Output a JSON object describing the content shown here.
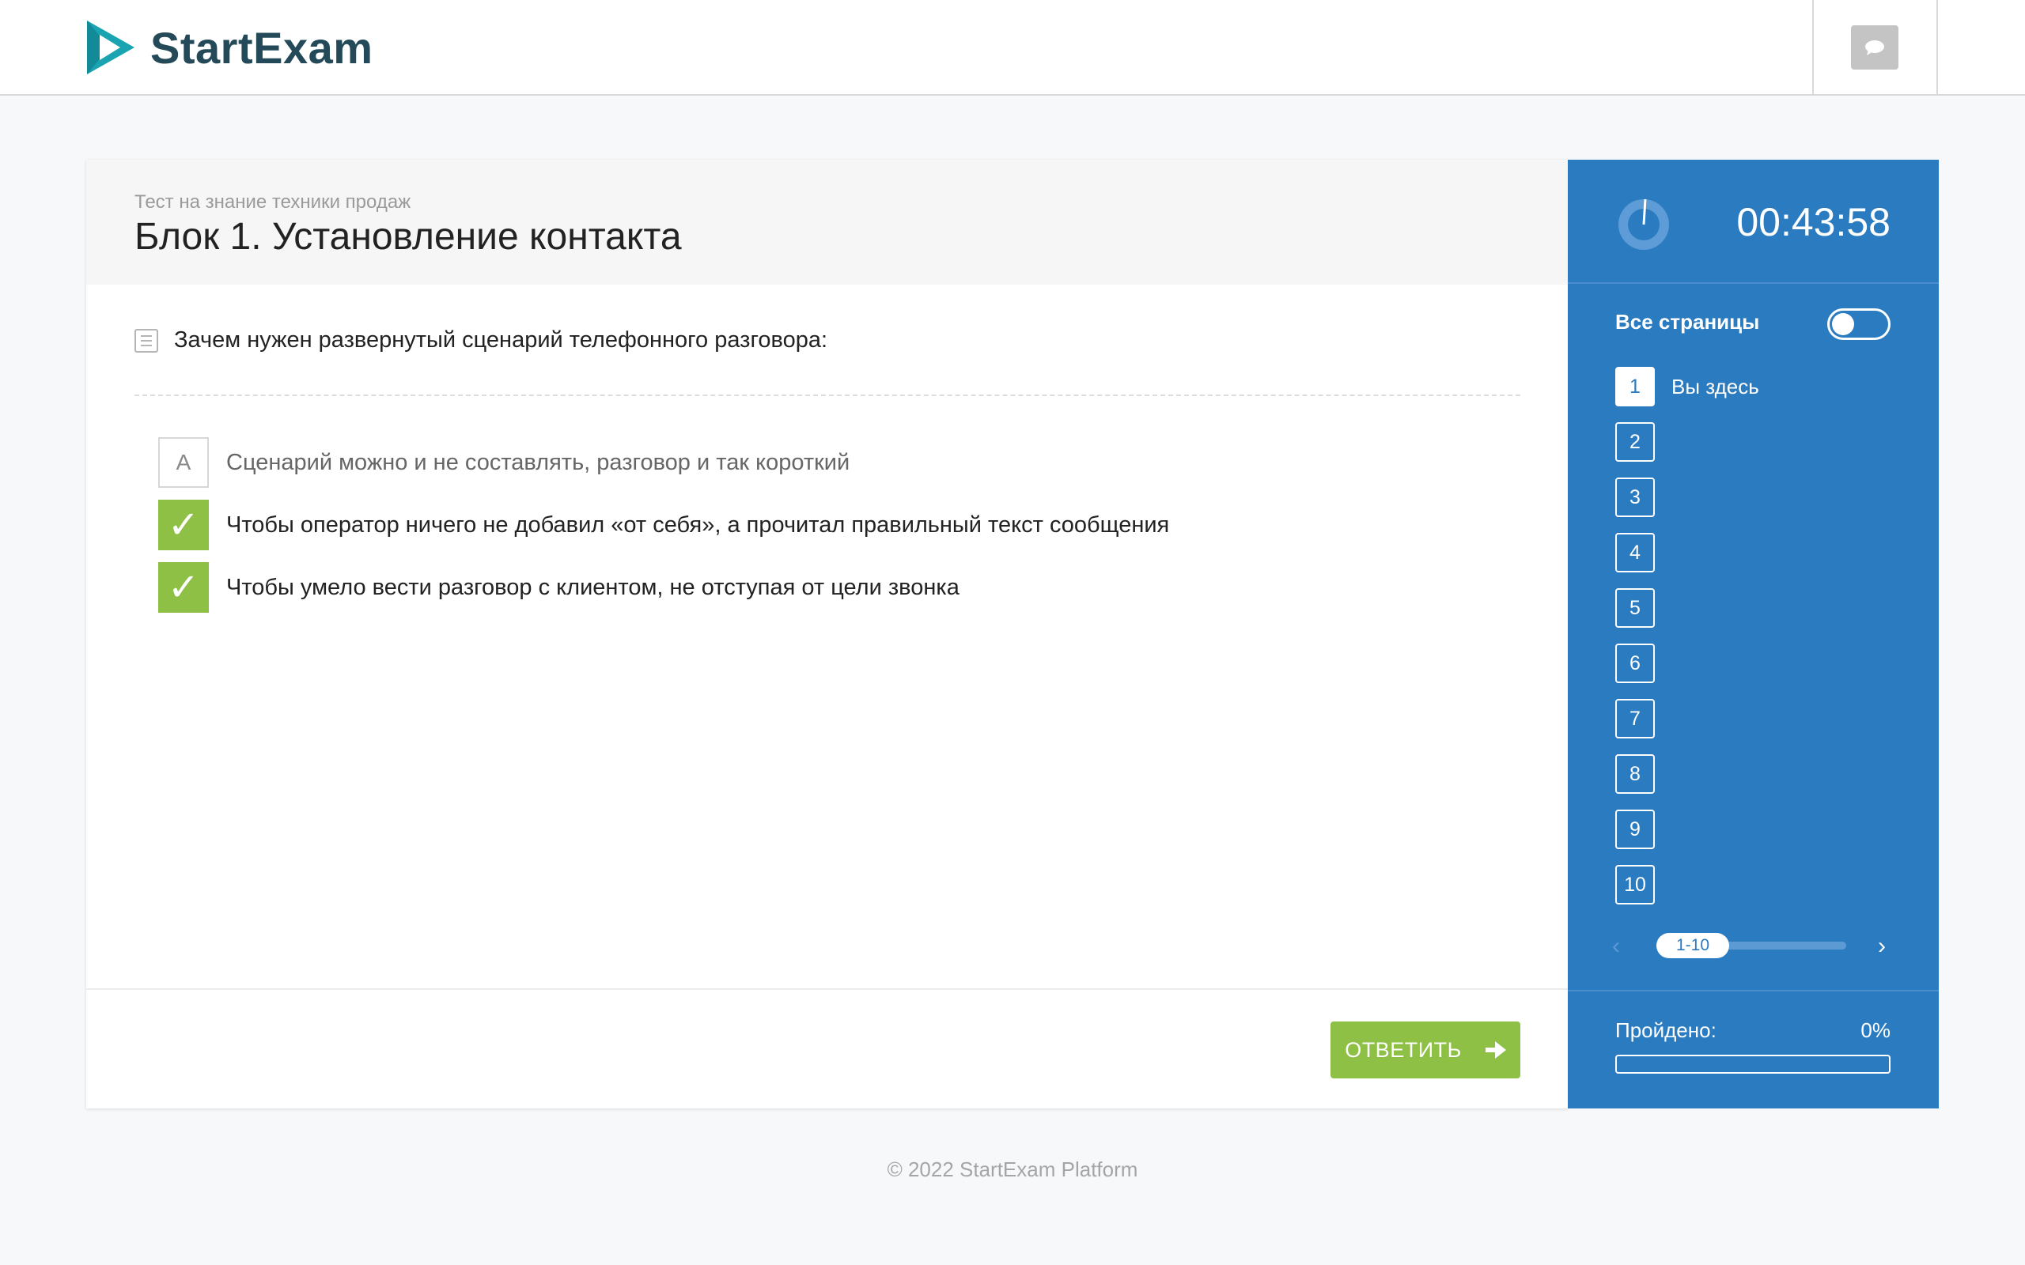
{
  "header": {
    "logo_text": "StartExam",
    "chat_icon": "chat-bubble-icon"
  },
  "test": {
    "subtitle": "Тест на знание техники продаж",
    "title": "Блок 1. Установление контакта",
    "question": "Зачем нужен развернутый сценарий телефонного разговора:",
    "answers": [
      {
        "marker": "A",
        "text": "Сценарий можно и не составлять, разговор и так короткий",
        "checked": false
      },
      {
        "marker": "✓",
        "text": "Чтобы оператор ничего не добавил «от себя», а прочитал правильный текст сообщения",
        "checked": true
      },
      {
        "marker": "✓",
        "text": "Чтобы умело вести разговор с клиентом, не отступая от цели звонка",
        "checked": true
      }
    ],
    "answer_button": "ОТВЕТИТЬ"
  },
  "sidebar": {
    "timer": "00:43:58",
    "all_pages_label": "Все страницы",
    "all_pages_on": false,
    "pages": [
      "1",
      "2",
      "3",
      "4",
      "5",
      "6",
      "7",
      "8",
      "9",
      "10"
    ],
    "current_page_label": "Вы здесь",
    "pager_range": "1-10",
    "progress_label": "Пройдено:",
    "progress_value": "0%",
    "progress_fraction": 0
  },
  "footer": {
    "copyright": "© 2022 StartExam Platform"
  },
  "colors": {
    "brand_blue": "#2b7bc1",
    "accent_green": "#8dc045",
    "logo_teal": "#1aa3b0"
  }
}
